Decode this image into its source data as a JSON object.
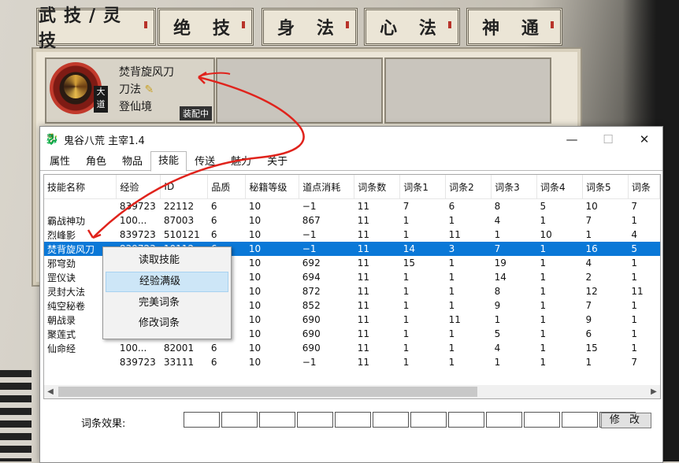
{
  "game": {
    "tabs": [
      "武技/灵技",
      "绝 技",
      "身 法",
      "心 法",
      "神 通"
    ],
    "skill_card": {
      "name": "焚背旋风刀",
      "type": "刀法",
      "realm": "登仙境",
      "badge_top": "大",
      "badge_bottom": "道",
      "status": "装配中"
    }
  },
  "window": {
    "title": "鬼谷八荒 主宰1.4",
    "app_icon": "app-icon",
    "controls": {
      "minimize": "—",
      "maximize": "☐",
      "close": "✕"
    },
    "tabs": [
      "属性",
      "角色",
      "物品",
      "技能",
      "传送",
      "魅力",
      "关于"
    ],
    "active_tab": "技能"
  },
  "table": {
    "columns": [
      "技能名称",
      "经验",
      "ID",
      "品质",
      "秘籍等级",
      "道点消耗",
      "词条数",
      "词条1",
      "词条2",
      "词条3",
      "词条4",
      "词条5",
      "词条"
    ],
    "rows": [
      [
        "",
        "839723",
        "22112",
        "6",
        "10",
        "−1",
        "11",
        "7",
        "6",
        "8",
        "5",
        "10",
        "7"
      ],
      [
        "霸战神功",
        "100...",
        "87003",
        "6",
        "10",
        "867",
        "11",
        "1",
        "1",
        "4",
        "1",
        "7",
        "1"
      ],
      [
        "烈峰影",
        "839723",
        "510121",
        "6",
        "10",
        "−1",
        "11",
        "1",
        "11",
        "1",
        "10",
        "1",
        "4"
      ],
      [
        "焚背旋风刀",
        "839723",
        "10112",
        "6",
        "10",
        "−1",
        "11",
        "14",
        "3",
        "7",
        "1",
        "16",
        "5"
      ],
      [
        "邪穹劲",
        "",
        "",
        "",
        "10",
        "692",
        "11",
        "15",
        "1",
        "19",
        "1",
        "4",
        "1"
      ],
      [
        "罡仪诀",
        "",
        "",
        "",
        "10",
        "694",
        "11",
        "1",
        "1",
        "14",
        "1",
        "2",
        "1"
      ],
      [
        "灵封大法",
        "",
        "",
        "",
        "10",
        "872",
        "11",
        "1",
        "1",
        "8",
        "1",
        "12",
        "11"
      ],
      [
        "纯空秘卷",
        "",
        "",
        "",
        "10",
        "852",
        "11",
        "1",
        "1",
        "9",
        "1",
        "7",
        "1"
      ],
      [
        "朝战录",
        "",
        "",
        "",
        "10",
        "690",
        "11",
        "1",
        "11",
        "1",
        "1",
        "9",
        "1"
      ],
      [
        "聚莲式",
        "100...",
        "83001",
        "6",
        "10",
        "690",
        "11",
        "1",
        "1",
        "5",
        "1",
        "6",
        "1"
      ],
      [
        "仙命经",
        "100...",
        "82001",
        "6",
        "10",
        "690",
        "11",
        "1",
        "1",
        "4",
        "1",
        "15",
        "1"
      ],
      [
        "",
        "839723",
        "33111",
        "6",
        "10",
        "−1",
        "11",
        "1",
        "1",
        "1",
        "1",
        "1",
        "7"
      ]
    ],
    "selected_row": 3
  },
  "context_menu": {
    "items": [
      "读取技能",
      "经验满级",
      "完美词条",
      "修改词条"
    ],
    "hover_index": 1
  },
  "effects": {
    "label": "词条效果:",
    "box_count": 12,
    "modify_button": "修 改"
  },
  "colors": {
    "selection": "#0a78d7",
    "annotation": "#e0231c",
    "menu_hover": "#cde6f7"
  }
}
